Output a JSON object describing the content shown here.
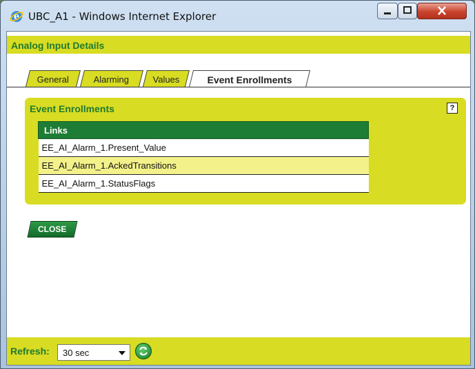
{
  "window": {
    "title": "UBC_A1 - Windows Internet Explorer",
    "controls": [
      "minimize-icon",
      "maximize-icon",
      "close-icon"
    ]
  },
  "header": {
    "title": "Analog Input Details"
  },
  "tabs": [
    {
      "label": "General",
      "active": false
    },
    {
      "label": "Alarming",
      "active": false
    },
    {
      "label": "Values",
      "active": false
    },
    {
      "label": "Event Enrollments",
      "active": true
    }
  ],
  "panel": {
    "title": "Event Enrollments",
    "help_label": "?",
    "table": {
      "header": "Links",
      "rows": [
        "EE_AI_Alarm_1.Present_Value",
        "EE_AI_Alarm_1.AckedTransitions",
        "EE_AI_Alarm_1.StatusFlags"
      ]
    }
  },
  "close_button": {
    "label": "CLOSE"
  },
  "footer": {
    "refresh_label": "Refresh:",
    "refresh_value": "30 sec"
  },
  "colors": {
    "accent_yellow": "#d8dc22",
    "accent_green": "#1e7d34",
    "row_highlight": "#f3f18a"
  }
}
